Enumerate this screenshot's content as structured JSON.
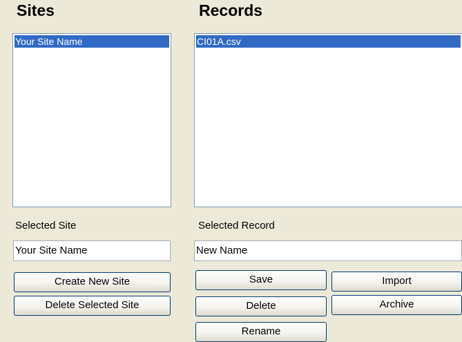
{
  "sites": {
    "heading": "Sites",
    "items": [
      "Your Site Name"
    ],
    "selected_label": "Selected Site",
    "selected_value": "Your Site Name",
    "create_button": "Create New Site",
    "delete_button": "Delete Selected Site"
  },
  "records": {
    "heading": "Records",
    "items": [
      "CI01A.csv"
    ],
    "selected_label": "Selected Record",
    "selected_value": "New Name",
    "save_button": "Save",
    "import_button": "Import",
    "delete_button": "Delete",
    "archive_button": "Archive",
    "rename_button": "Rename"
  },
  "colors": {
    "background": "#ece9d8",
    "selection": "#316ac5",
    "list_border": "#7f9db9",
    "button_border": "#003c74"
  }
}
